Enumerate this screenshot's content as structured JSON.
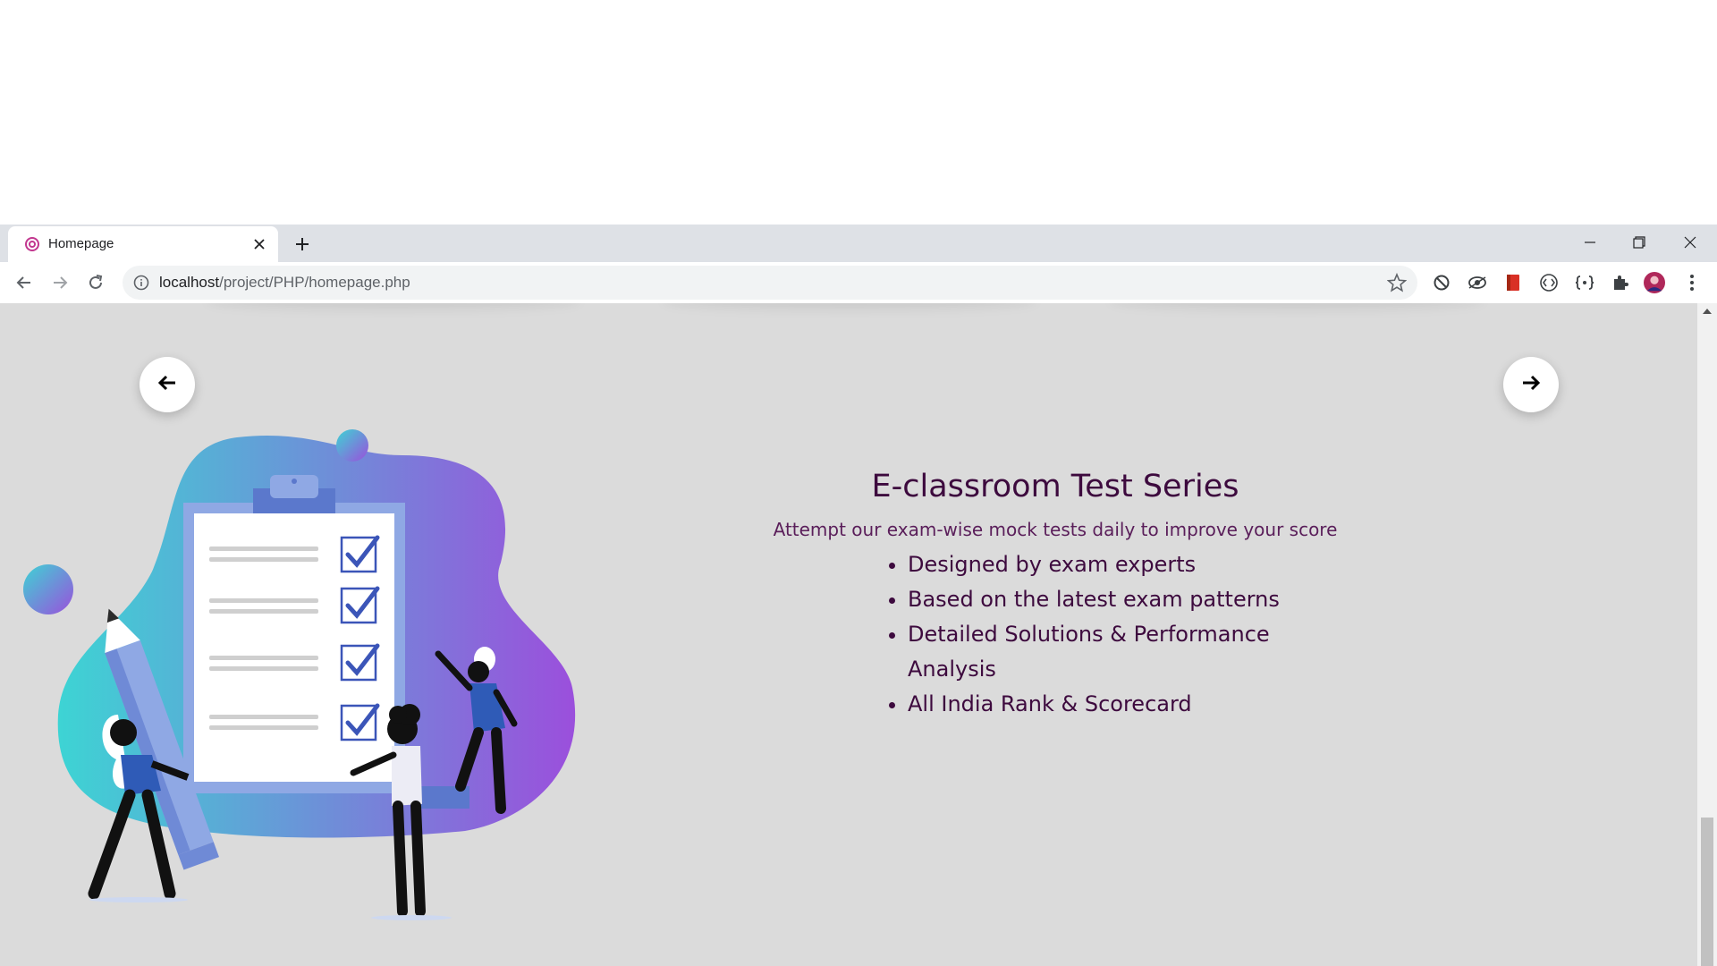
{
  "browser": {
    "tab_title": "Homepage",
    "url_host": "localhost",
    "url_path": "/project/PHP/homepage.php"
  },
  "page": {
    "heading": "E-classroom Test Series",
    "subtitle": "Attempt our exam-wise mock tests daily to improve your score",
    "features": [
      "Designed by exam experts",
      "Based on the latest exam patterns",
      "Detailed Solutions & Performance Analysis",
      "All India Rank & Scorecard"
    ]
  },
  "colors": {
    "page_bg": "#dbdbdb",
    "heading": "#3d0a3e",
    "blob_start": "#3dd4d4",
    "blob_end": "#9b4fdc",
    "checkmark": "#3b55b8"
  },
  "icons": {
    "prev": "arrow-left-icon",
    "next": "arrow-right-icon"
  }
}
